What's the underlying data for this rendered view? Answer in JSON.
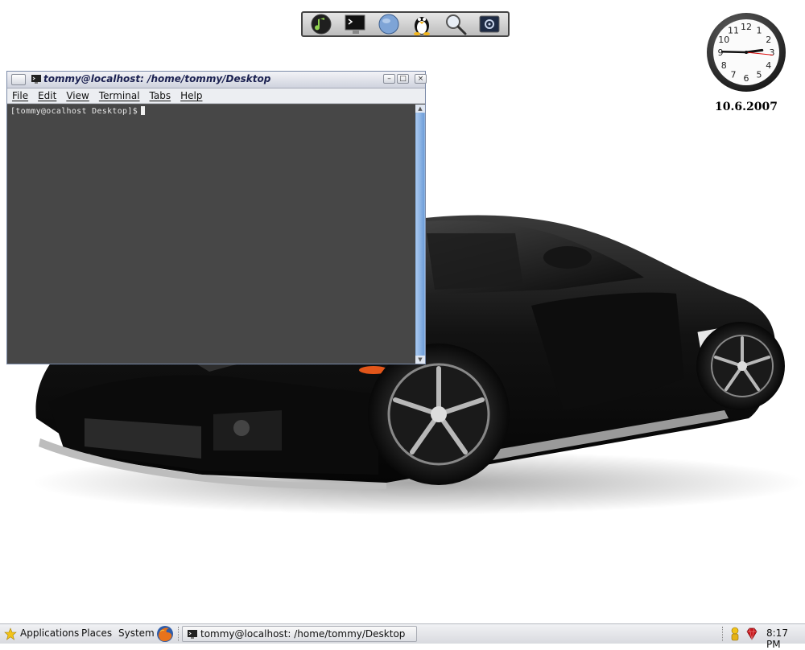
{
  "dock": {
    "items": [
      "music-player-icon",
      "terminal-icon",
      "globe-icon",
      "tux-icon",
      "magnifier-icon",
      "settings-icon"
    ]
  },
  "clock_widget": {
    "numbers": [
      "12",
      "1",
      "2",
      "3",
      "4",
      "5",
      "6",
      "7",
      "8",
      "9",
      "10",
      "11"
    ],
    "time_shown": "2:45:16",
    "date": "10.6.2007"
  },
  "terminal": {
    "title": "tommy@localhost: /home/tommy/Desktop",
    "menu": [
      "File",
      "Edit",
      "View",
      "Terminal",
      "Tabs",
      "Help"
    ],
    "prompt": "[tommy@ocalhost Desktop]$",
    "background_color": "#5a5a5a"
  },
  "panel": {
    "menus": [
      "Applications",
      "Places",
      "System"
    ],
    "taskbar": {
      "label": "tommy@localhost: /home/tommy/Desktop"
    },
    "clock": "8:17 PM"
  },
  "colors": {
    "panel_bg": "#e4e6ea",
    "scrollbar": "#8fb6e3",
    "title_text": "#1a2050"
  }
}
